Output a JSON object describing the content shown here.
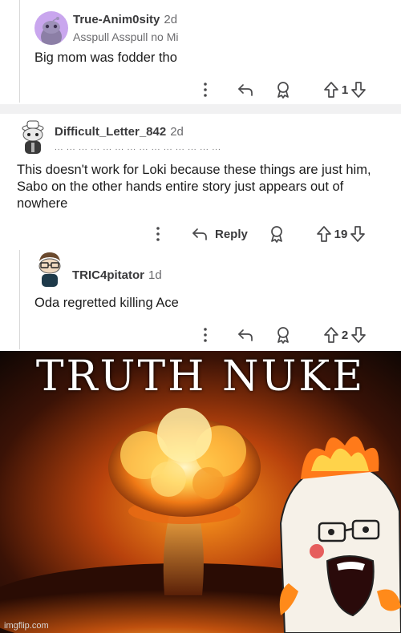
{
  "comments": [
    {
      "username": "True-Anim0sity",
      "age": "2d",
      "flair": "Asspull Asspull no Mi",
      "body": "Big mom was fodder tho",
      "votes": "1"
    },
    {
      "username": "Difficult_Letter_842",
      "age": "2d",
      "flair": "... ... ... ... ... ... ... ... ... ... ... ... ... ...",
      "body": "This doesn't work for Loki because these things are just him, Sabo on the other hands entire story just appears out of nowhere",
      "reply_label": "Reply",
      "votes": "19"
    },
    {
      "username": "TRIC4pitator",
      "age": "1d",
      "body": "Oda regretted killing Ace",
      "votes": "2"
    }
  ],
  "meme": {
    "title": "TRUTH NUKE",
    "watermark": "imgflip.com"
  },
  "icons": {
    "more": "more-vertical-icon",
    "reply": "reply-arrow-icon",
    "award": "award-icon",
    "upvote": "upvote-icon",
    "downvote": "downvote-icon"
  },
  "colors": {
    "thread_line": "#d8d8d8",
    "divider": "#f1f1f2",
    "avatar1_bg": "#c9a6ee",
    "explosion": "#ff9b1e"
  }
}
